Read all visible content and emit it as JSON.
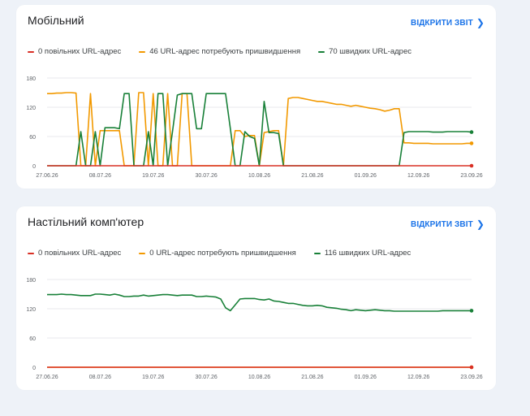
{
  "cards": [
    {
      "title": "Мобільний",
      "link_label": "ВІДКРИТИ ЗВІТ",
      "legend": [
        "0 повільних URL-адрес",
        "46 URL-адрес потребують пришвидшення",
        "70 швидких URL-адрес"
      ]
    },
    {
      "title": "Настільний комп'ютер",
      "link_label": "ВІДКРИТИ ЗВІТ",
      "legend": [
        "0 повільних URL-адрес",
        "0 URL-адрес потребують пришвидшення",
        "116 швидких URL-адрес"
      ]
    }
  ],
  "colors": {
    "slow": "#d93025",
    "needs": "#f29900",
    "fast": "#188038",
    "link": "#1a73e8"
  },
  "icons": {
    "link_chevron": "chevron-right-icon"
  },
  "chart_data": [
    {
      "type": "line",
      "title": "Мобільний",
      "ylim": [
        0,
        180
      ],
      "yticks": [
        0,
        60,
        120,
        180
      ],
      "xtick_labels": [
        "27.06.26",
        "08.07.26",
        "19.07.26",
        "30.07.26",
        "10.08.26",
        "21.08.26",
        "01.09.26",
        "12.09.26",
        "23.09.26"
      ],
      "series": [
        {
          "name": "0 повільних URL-адрес",
          "color": "#d93025",
          "values": [
            0,
            0,
            0,
            0,
            0,
            0,
            0,
            0,
            0,
            0,
            0,
            0,
            0,
            0,
            0,
            0,
            0,
            0,
            0,
            0,
            0,
            0,
            0,
            0,
            0,
            0,
            0,
            0,
            0,
            0,
            0,
            0,
            0,
            0,
            0,
            0,
            0,
            0,
            0,
            0,
            0,
            0,
            0,
            0,
            0,
            0,
            0,
            0,
            0,
            0,
            0,
            0,
            0,
            0,
            0,
            0,
            0,
            0,
            0,
            0,
            0,
            0,
            0,
            0,
            0,
            0,
            0,
            0,
            0,
            0,
            0,
            0,
            0,
            0,
            0,
            0,
            0,
            0,
            0,
            0,
            0,
            0,
            0,
            0,
            0,
            0,
            0,
            0,
            0
          ]
        },
        {
          "name": "46 URL-адрес потребують пришвидшення",
          "color": "#f29900",
          "values": [
            148,
            148,
            149,
            149,
            150,
            150,
            149,
            0,
            0,
            148,
            0,
            72,
            72,
            72,
            72,
            72,
            0,
            0,
            0,
            150,
            150,
            0,
            148,
            0,
            0,
            148,
            0,
            0,
            148,
            148,
            0,
            0,
            0,
            0,
            0,
            0,
            0,
            0,
            0,
            72,
            72,
            60,
            62,
            62,
            0,
            68,
            70,
            72,
            72,
            0,
            138,
            140,
            140,
            138,
            136,
            134,
            132,
            132,
            130,
            128,
            126,
            126,
            124,
            122,
            124,
            122,
            120,
            118,
            117,
            115,
            112,
            114,
            117,
            117,
            47,
            47,
            46,
            46,
            46,
            46,
            45,
            45,
            45,
            45,
            45,
            45,
            45,
            46,
            46
          ]
        },
        {
          "name": "70 швидких URL-адрес",
          "color": "#188038",
          "values": [
            0,
            0,
            0,
            0,
            0,
            0,
            0,
            70,
            0,
            0,
            70,
            0,
            78,
            78,
            78,
            76,
            148,
            148,
            0,
            0,
            0,
            70,
            0,
            148,
            148,
            0,
            70,
            145,
            148,
            148,
            148,
            76,
            76,
            148,
            148,
            148,
            148,
            148,
            76,
            0,
            0,
            70,
            60,
            56,
            0,
            132,
            68,
            68,
            66,
            0,
            0,
            0,
            0,
            0,
            0,
            0,
            0,
            0,
            0,
            0,
            0,
            0,
            0,
            0,
            0,
            0,
            0,
            0,
            0,
            0,
            0,
            0,
            0,
            0,
            68,
            70,
            70,
            70,
            70,
            70,
            69,
            69,
            69,
            70,
            70,
            70,
            70,
            70,
            69
          ]
        }
      ]
    },
    {
      "type": "line",
      "title": "Настільний комп'ютер",
      "ylim": [
        0,
        180
      ],
      "yticks": [
        0,
        60,
        120,
        180
      ],
      "xtick_labels": [
        "27.06.26",
        "08.07.26",
        "19.07.26",
        "30.07.26",
        "10.08.26",
        "21.08.26",
        "01.09.26",
        "12.09.26",
        "23.09.26"
      ],
      "series": [
        {
          "name": "0 повільних URL-адрес",
          "color": "#d93025",
          "values": [
            0,
            0,
            0,
            0,
            0,
            0,
            0,
            0,
            0,
            0,
            0,
            0,
            0,
            0,
            0,
            0,
            0,
            0,
            0,
            0,
            0,
            0,
            0,
            0,
            0,
            0,
            0,
            0,
            0,
            0,
            0,
            0,
            0,
            0,
            0,
            0,
            0,
            0,
            0,
            0,
            0,
            0,
            0,
            0,
            0,
            0,
            0,
            0,
            0,
            0,
            0,
            0,
            0,
            0,
            0,
            0,
            0,
            0,
            0,
            0,
            0,
            0,
            0,
            0,
            0,
            0,
            0,
            0,
            0,
            0,
            0,
            0,
            0,
            0,
            0,
            0,
            0,
            0,
            0,
            0,
            0,
            0,
            0,
            0,
            0,
            0,
            0,
            0,
            0
          ]
        },
        {
          "name": "0 URL-адрес потребують пришвидшення",
          "color": "#f29900",
          "values": [
            0,
            0,
            0,
            0,
            0,
            0,
            0,
            0,
            0,
            0,
            0,
            0,
            0,
            0,
            0,
            0,
            0,
            0,
            0,
            0,
            0,
            0,
            0,
            0,
            0,
            0,
            0,
            0,
            0,
            0,
            0,
            0,
            0,
            0,
            0,
            0,
            0,
            0,
            0,
            0,
            0,
            0,
            0,
            0,
            0,
            0,
            0,
            0,
            0,
            0,
            0,
            0,
            0,
            0,
            0,
            0,
            0,
            0,
            0,
            0,
            0,
            0,
            0,
            0,
            0,
            0,
            0,
            0,
            0,
            0,
            0,
            0,
            0,
            0,
            0,
            0,
            0,
            0,
            0,
            0,
            0,
            0,
            0,
            0,
            0,
            0,
            0,
            0,
            0
          ]
        },
        {
          "name": "116 швидких URL-адрес",
          "color": "#188038",
          "values": [
            149,
            149,
            149,
            150,
            149,
            149,
            148,
            147,
            147,
            147,
            150,
            150,
            149,
            148,
            150,
            148,
            145,
            145,
            146,
            146,
            148,
            146,
            147,
            148,
            149,
            149,
            148,
            147,
            148,
            148,
            148,
            145,
            145,
            146,
            145,
            144,
            140,
            122,
            116,
            128,
            140,
            141,
            141,
            141,
            139,
            138,
            140,
            136,
            135,
            133,
            131,
            131,
            129,
            127,
            126,
            126,
            127,
            126,
            123,
            122,
            121,
            119,
            118,
            116,
            118,
            117,
            116,
            117,
            118,
            117,
            116,
            116,
            115,
            115,
            115,
            115,
            115,
            115,
            115,
            115,
            115,
            115,
            116,
            116,
            116,
            116,
            116,
            116,
            116
          ]
        }
      ]
    }
  ]
}
